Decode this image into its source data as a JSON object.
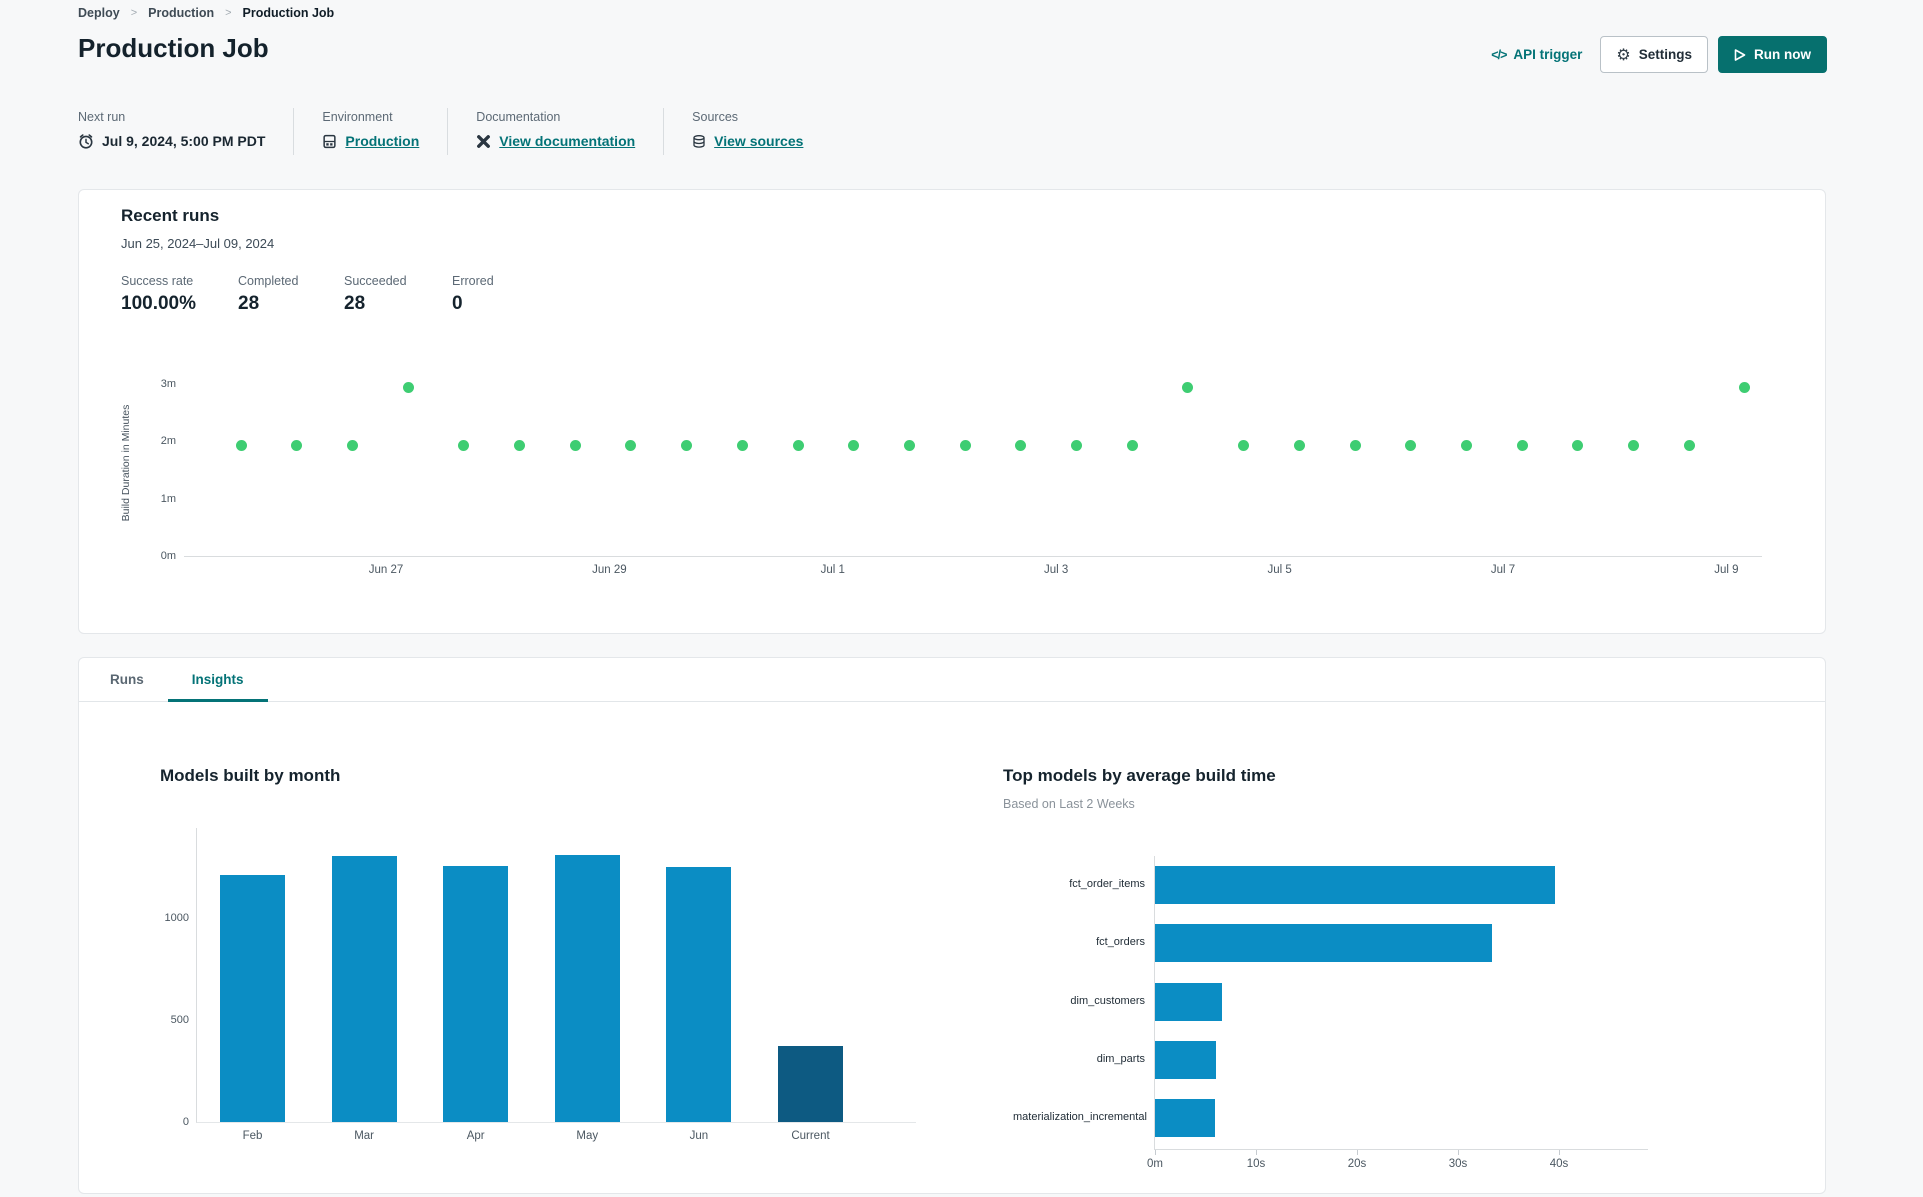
{
  "breadcrumb": {
    "separator": ">",
    "items": [
      {
        "label": "Deploy"
      },
      {
        "label": "Production"
      },
      {
        "label": "Production Job"
      }
    ]
  },
  "header": {
    "title": "Production Job"
  },
  "actions": {
    "api_trigger": "API trigger",
    "settings": "Settings",
    "run_now": "Run now"
  },
  "icons": {
    "api_trigger_glyph": "</>",
    "settings_gear_glyph": "⚙"
  },
  "info_bar": {
    "next_run": {
      "label": "Next run",
      "value": "Jul 9, 2024, 5:00 PM PDT"
    },
    "environment": {
      "label": "Environment",
      "value": "Production"
    },
    "documentation": {
      "label": "Documentation",
      "value": "View documentation"
    },
    "sources": {
      "label": "Sources",
      "value": "View sources"
    }
  },
  "recent_runs": {
    "title": "Recent runs",
    "date_range": "Jun 25, 2024–Jul 09, 2024",
    "stats": [
      {
        "label": "Success rate",
        "value": "100.00%"
      },
      {
        "label": "Completed",
        "value": "28"
      },
      {
        "label": "Succeeded",
        "value": "28"
      },
      {
        "label": "Errored",
        "value": "0"
      }
    ]
  },
  "tabs": [
    {
      "label": "Runs",
      "active": false
    },
    {
      "label": "Insights",
      "active": true
    }
  ],
  "colors": {
    "accent_teal": "#047377",
    "run_now_bg": "#06706e",
    "success_green": "#3ecd72",
    "bar_blue": "#0b8dc4",
    "bar_dark_blue": "#0d5a82",
    "page_bg": "#f7f8f9"
  },
  "chart_data": [
    {
      "id": "build_duration",
      "type": "scatter",
      "ylabel": "Build Duration in Minutes",
      "ytick_labels": [
        "0m",
        "1m",
        "2m",
        "3m"
      ],
      "xtick_labels": [
        "Jun 27",
        "Jun 29",
        "Jul 1",
        "Jul 3",
        "Jul 5",
        "Jul 7",
        "Jul 9"
      ],
      "ylim_minutes": [
        0,
        3.26
      ],
      "grid": false,
      "point_color": "#3ecd72",
      "points_minutes": [
        1.95,
        1.95,
        1.95,
        2.95,
        1.95,
        1.95,
        1.95,
        1.95,
        1.95,
        1.95,
        1.95,
        1.95,
        1.95,
        1.95,
        1.95,
        1.95,
        1.95,
        2.95,
        1.95,
        1.95,
        1.95,
        1.95,
        1.95,
        1.95,
        1.95,
        1.95,
        1.95,
        2.95
      ]
    },
    {
      "id": "models_by_month",
      "type": "bar",
      "title": "Models built by month",
      "categories": [
        "Feb",
        "Mar",
        "Apr",
        "May",
        "Jun",
        "Current"
      ],
      "values": [
        1210,
        1305,
        1255,
        1310,
        1250,
        375
      ],
      "yticks": [
        0,
        500,
        1000
      ],
      "ylim": [
        0,
        1446
      ],
      "grid": false,
      "bar_color": "#0b8dc4",
      "current_bar_color": "#0d5a82"
    },
    {
      "id": "top_models",
      "type": "bar-horizontal",
      "title": "Top models by average build time",
      "subtitle": "Based on Last 2 Weeks",
      "categories": [
        "fct_order_items",
        "fct_orders",
        "dim_customers",
        "dim_parts",
        "materialization_incremental"
      ],
      "values_seconds": [
        39.6,
        33.4,
        6.6,
        6.0,
        5.9
      ],
      "xtick_labels": [
        "0m",
        "10s",
        "20s",
        "30s",
        "40s"
      ],
      "xtick_seconds": [
        0,
        10,
        20,
        30,
        40
      ],
      "xlim_seconds": [
        0,
        48.9
      ],
      "grid": false,
      "bar_color": "#0b8dc4"
    }
  ]
}
